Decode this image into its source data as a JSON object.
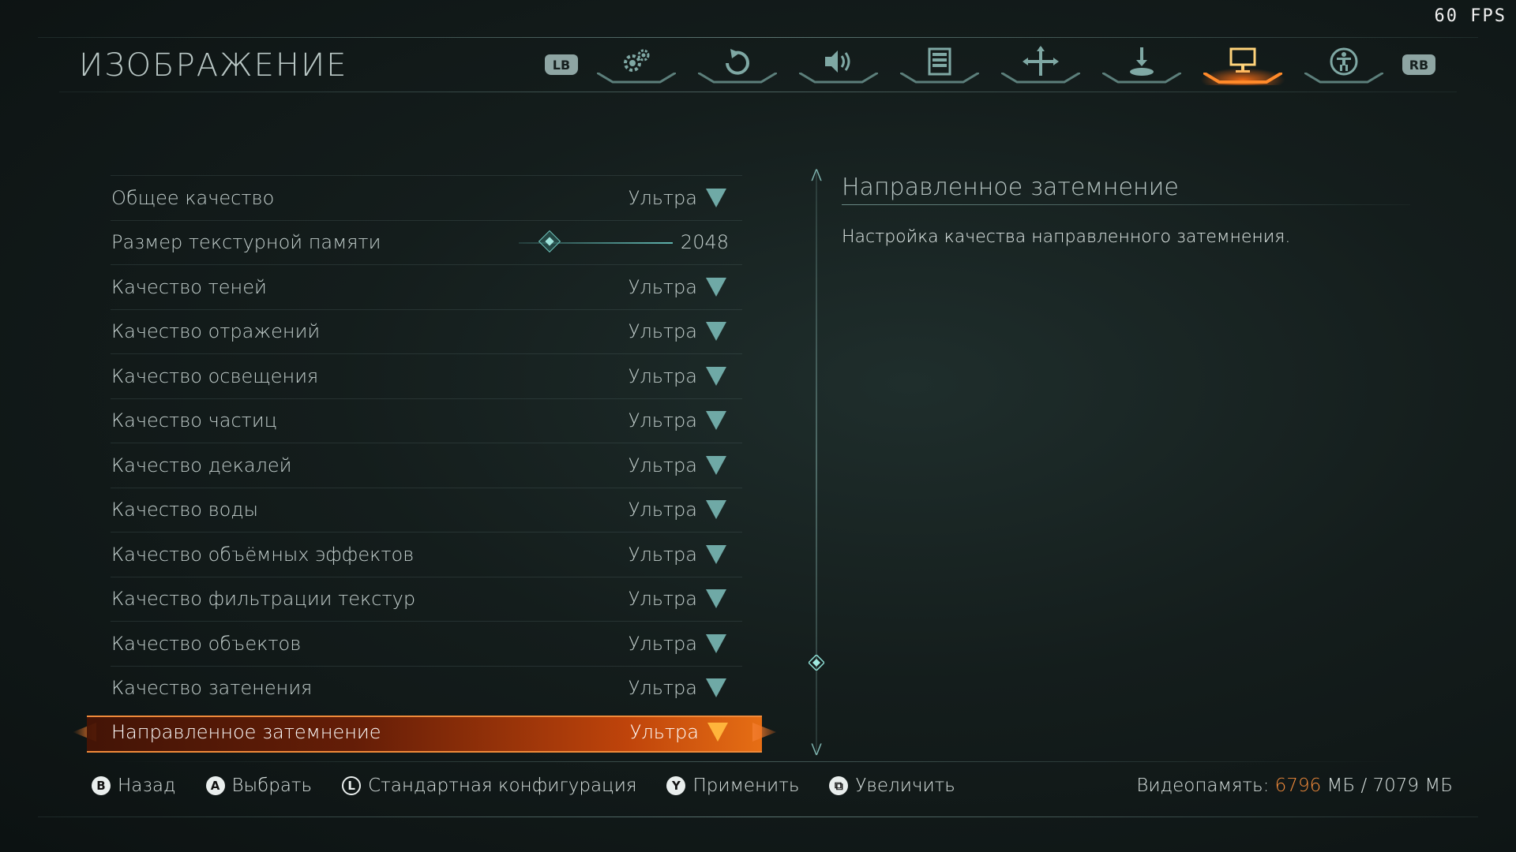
{
  "overlay": {
    "fps": "60 FPS"
  },
  "header": {
    "title": "ИЗОБРАЖЕНИЕ",
    "left_bumper": "LB",
    "right_bumper": "RB",
    "tabs": [
      {
        "icon": "gears-icon",
        "active": false
      },
      {
        "icon": "controller-refresh-icon",
        "active": false
      },
      {
        "icon": "speaker-icon",
        "active": false
      },
      {
        "icon": "list-icon",
        "active": false
      },
      {
        "icon": "crosshair-icon",
        "active": false
      },
      {
        "icon": "joystick-icon",
        "active": false
      },
      {
        "icon": "monitor-icon",
        "active": true
      },
      {
        "icon": "accessibility-icon",
        "active": false
      }
    ],
    "accent_color": "#f07a2a"
  },
  "settings": [
    {
      "label": "Общее качество",
      "value": "Ультра"
    },
    {
      "label": "Размер текстурной памяти",
      "value": "2048",
      "type": "slider",
      "slider_level": 0.2
    },
    {
      "label": "Качество теней",
      "value": "Ультра"
    },
    {
      "label": "Качество отражений",
      "value": "Ультра"
    },
    {
      "label": "Качество освещения",
      "value": "Ультра"
    },
    {
      "label": "Качество частиц",
      "value": "Ультра"
    },
    {
      "label": "Качество декалей",
      "value": "Ультра"
    },
    {
      "label": "Качество воды",
      "value": "Ультра"
    },
    {
      "label": "Качество объёмных эффектов",
      "value": "Ультра"
    },
    {
      "label": "Качество фильтрации текстур",
      "value": "Ультра"
    },
    {
      "label": "Качество объектов",
      "value": "Ультра"
    },
    {
      "label": "Качество затенения",
      "value": "Ультра"
    },
    {
      "label": "Направленное затемнение",
      "value": "Ультра",
      "selected": true
    }
  ],
  "description": {
    "title": "Направленное затемнение",
    "text": "Настройка качества направленного затемнения."
  },
  "footer": {
    "hints": [
      {
        "button": "B",
        "label": "Назад"
      },
      {
        "button": "A",
        "label": "Выбрать"
      },
      {
        "button": "L",
        "label": "Стандартная конфигурация"
      },
      {
        "button": "Y",
        "label": "Применить"
      },
      {
        "button": "⧉",
        "label": "Увеличить"
      }
    ],
    "vram_label": "Видеопамять:",
    "vram_used": "6796",
    "vram_rest": "МБ / 7079 МБ"
  }
}
